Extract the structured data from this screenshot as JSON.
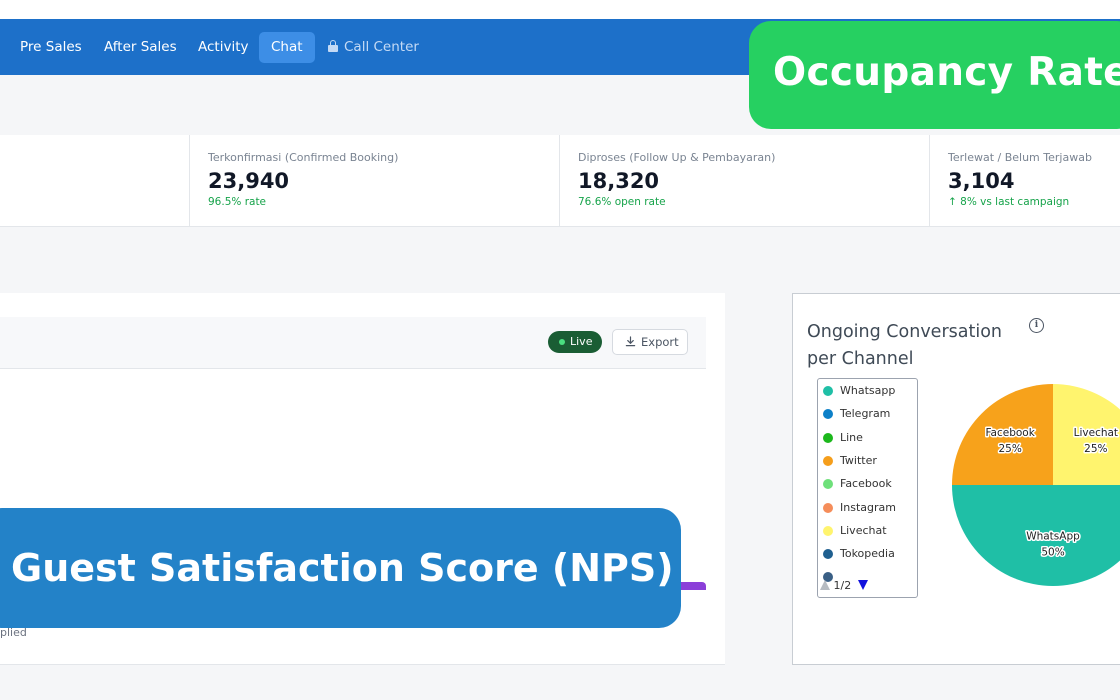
{
  "nav": {
    "items": [
      {
        "label": "Pre Sales"
      },
      {
        "label": "After Sales"
      },
      {
        "label": "Activity"
      },
      {
        "label": "Chat"
      },
      {
        "label": "Call Center"
      }
    ],
    "active": "Chat"
  },
  "stats": [
    {
      "label": "Terkonfirmasi (Confirmed Booking)",
      "value": "23,940",
      "sub": "96.5% rate"
    },
    {
      "label": "Diproses (Follow Up & Pembayaran)",
      "value": "18,320",
      "sub": "76.6% open rate"
    },
    {
      "label": "Terlewat / Belum Terjawab",
      "value": "3,104",
      "sub": "↑ 8% vs last campaign"
    }
  ],
  "panel": {
    "live_label": "Live",
    "export_label": "Export",
    "applied_text": "plied"
  },
  "chart_card": {
    "title": "Ongoing Conversation per Channel",
    "legend": [
      {
        "label": "Whatsapp",
        "color": "#1fbfa6"
      },
      {
        "label": "Telegram",
        "color": "#0d80c8"
      },
      {
        "label": "Line",
        "color": "#1cb81c"
      },
      {
        "label": "Twitter",
        "color": "#f59e1b"
      },
      {
        "label": "Facebook",
        "color": "#6ee07a"
      },
      {
        "label": "Instagram",
        "color": "#f58d5a"
      },
      {
        "label": "Livechat",
        "color": "#fff46e"
      },
      {
        "label": "Tokopedia",
        "color": "#1f5f8f"
      },
      {
        "label": "",
        "color": "#3a5f85"
      }
    ],
    "pager": "1/2"
  },
  "chart_data": {
    "type": "pie",
    "title": "Ongoing Conversation per Channel",
    "slices": [
      {
        "label": "WhatsApp",
        "value": 50,
        "display": "50%",
        "color": "#1fbfa6"
      },
      {
        "label": "Facebook",
        "value": 25,
        "display": "25%",
        "color": "#f7a21b"
      },
      {
        "label": "Livechat",
        "value": 25,
        "display": "25%",
        "color": "#fff46e"
      }
    ],
    "legend_position": "left"
  },
  "overlays": {
    "occupancy": "Occupancy Rate",
    "nps": "Guest Satisfaction Score (NPS)"
  }
}
